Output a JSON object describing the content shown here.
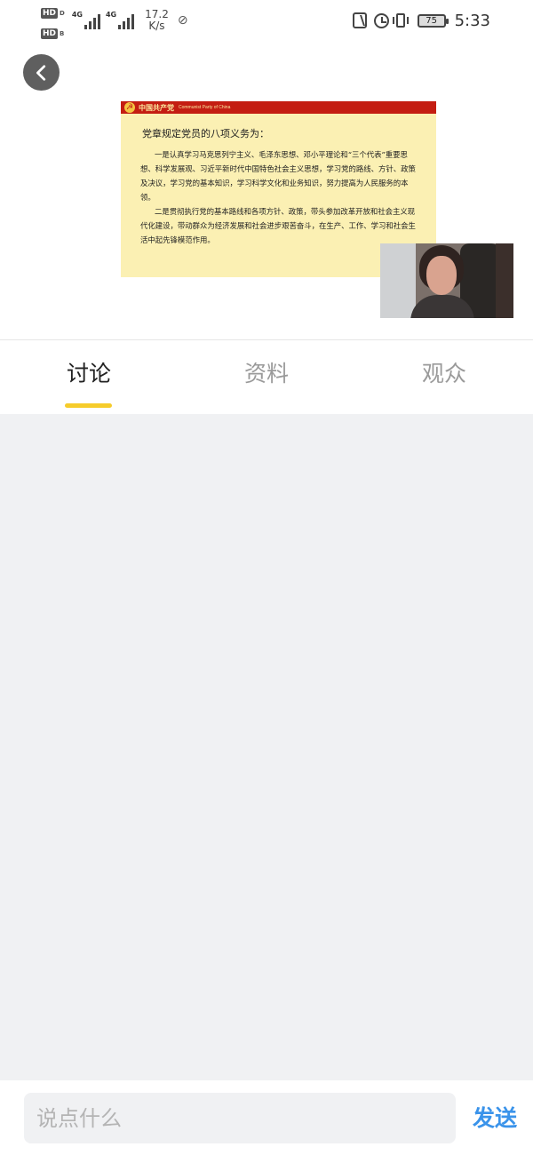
{
  "status_bar": {
    "hd_top": "HD",
    "hd_top_sub": "D",
    "hd_bottom": "HD",
    "hd_bottom_sub": "B",
    "net1": "4G",
    "net2": "4G",
    "speed_value": "17.2",
    "speed_unit": "K/s",
    "battery": "75",
    "time": "5:33",
    "icons": [
      "hd-icon",
      "signal-icon",
      "wifi-off-icon",
      "nfc-icon",
      "alarm-icon",
      "vibrate-icon",
      "battery-icon"
    ]
  },
  "player": {
    "back_icon": "back-arrow-icon",
    "slide": {
      "header_cn": "中国共产党",
      "header_en": "Communist Party of China",
      "title": "党章规定党员的八项义务为：",
      "paragraphs": [
        "一是认真学习马克思列宁主义、毛泽东思想、邓小平理论和“三个代表”重要思想、科学发展观、习近平新时代中国特色社会主义思想，学习党的路线、方针、政策及决议，学习党的基本知识，学习科学文化和业务知识，努力提高为人民服务的本领。",
        "二是贯彻执行党的基本路线和各项方针、政策，带头参加改革开放和社会主义现代化建设，带动群众为经济发展和社会进步艰苦奋斗，在生产、工作、学习和社会生活中起先锋模范作用。"
      ]
    }
  },
  "tabs": [
    {
      "label": "讨论",
      "active": true
    },
    {
      "label": "资料",
      "active": false
    },
    {
      "label": "观众",
      "active": false
    }
  ],
  "composer": {
    "placeholder": "说点什么",
    "value": "",
    "send_label": "发送"
  },
  "colors": {
    "accent_yellow": "#f6cc2b",
    "send_blue": "#3a93ea",
    "panel_gray": "#f0f1f3",
    "slide_bg": "#fbf0b3",
    "slide_header_red": "#c41d12"
  }
}
